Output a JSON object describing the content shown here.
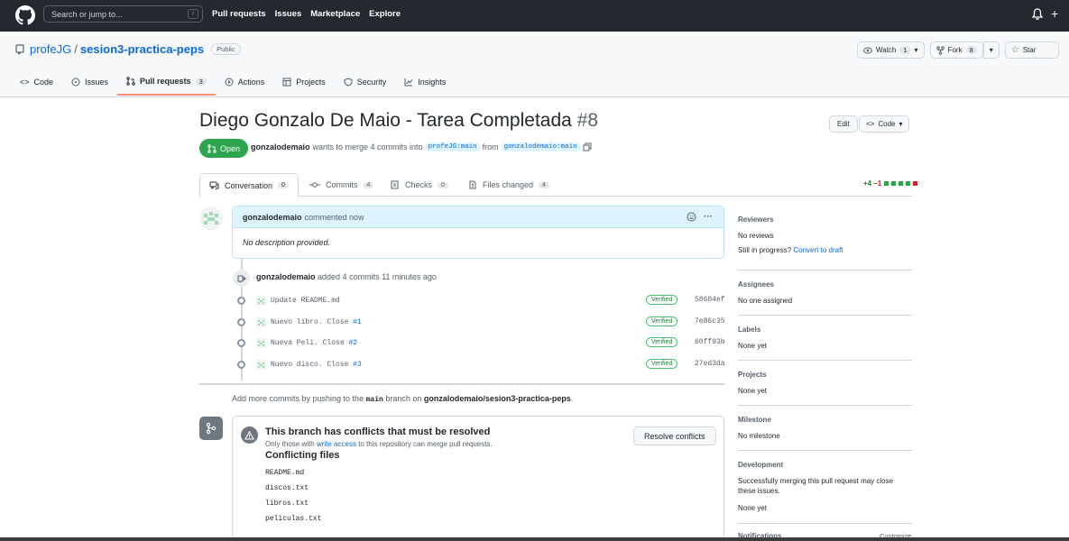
{
  "header": {
    "search_placeholder": "Search or jump to...",
    "search_shortcut": "/",
    "nav": [
      "Pull requests",
      "Issues",
      "Marketplace",
      "Explore"
    ],
    "plus": "+"
  },
  "repo": {
    "owner": "profeJG",
    "separator": "/",
    "name": "sesion3-practica-peps",
    "visibility": "Public",
    "watch_label": "Watch",
    "watch_count": "1",
    "fork_label": "Fork",
    "fork_count": "8",
    "star_label": "Star",
    "tabs": [
      {
        "label": "Code"
      },
      {
        "label": "Issues"
      },
      {
        "label": "Pull requests",
        "count": "3"
      },
      {
        "label": "Actions"
      },
      {
        "label": "Projects"
      },
      {
        "label": "Security"
      },
      {
        "label": "Insights"
      }
    ]
  },
  "pr": {
    "title": "Diego Gonzalo De Maio - Tarea Completada",
    "number": "#8",
    "edit_label": "Edit",
    "code_label": "Code",
    "state": "Open",
    "author": "gonzalodemaio",
    "merge_text": "wants to merge 4 commits into",
    "base_branch": "profeJG:main",
    "from_text": "from",
    "head_branch": "gonzalodemaio:main",
    "tabs": [
      {
        "label": "Conversation",
        "count": "0"
      },
      {
        "label": "Commits",
        "count": "4"
      },
      {
        "label": "Checks",
        "count": "0"
      },
      {
        "label": "Files changed",
        "count": "4"
      }
    ],
    "additions": "+4",
    "deletions": "−1"
  },
  "comment": {
    "author": "gonzalodemaio",
    "action": "commented now",
    "body": "No description provided.",
    "more": "···"
  },
  "push": {
    "author": "gonzalodemaio",
    "text": "added 4 commits 11 minutes ago"
  },
  "commits": [
    {
      "message": "Update README.md",
      "ref": "",
      "verified": "Verified",
      "sha": "58604ef"
    },
    {
      "message": "Nuevo libro. Close",
      "ref": "#1",
      "verified": "Verified",
      "sha": "7e86c35"
    },
    {
      "message": "Nueva Peli. Close",
      "ref": "#2",
      "verified": "Verified",
      "sha": "60ff93b"
    },
    {
      "message": "Nuevo disco. Close",
      "ref": "#3",
      "verified": "Verified",
      "sha": "27ed3da"
    }
  ],
  "addmore": {
    "pre": "Add more commits by pushing to the",
    "branch": "main",
    "mid": "branch on",
    "repo": "gonzalodemaio/sesion3-practica-peps",
    "end": "."
  },
  "conflicts": {
    "title": "This branch has conflicts that must be resolved",
    "sub_pre": "Only those with",
    "sub_link": "write access",
    "sub_post": "to this repository can merge pull requests.",
    "files_heading": "Conflicting files",
    "files": [
      "README.md",
      "discos.txt",
      "libros.txt",
      "peliculas.txt"
    ],
    "resolve_label": "Resolve conflicts"
  },
  "sidebar": {
    "reviewers_h": "Reviewers",
    "reviewers_v": "No reviews",
    "progress_pre": "Still in progress?",
    "progress_link": "Convert to draft",
    "assignees_h": "Assignees",
    "assignees_v": "No one assigned",
    "labels_h": "Labels",
    "labels_v": "None yet",
    "projects_h": "Projects",
    "projects_v": "None yet",
    "milestone_h": "Milestone",
    "milestone_v": "No milestone",
    "development_h": "Development",
    "development_v": "Successfully merging this pull request may close these issues.",
    "development_v2": "None yet",
    "notifications_h": "Notifications",
    "customize": "Customize"
  },
  "colors": {
    "open_green": "#2da44e",
    "link_blue": "#0969da",
    "header_dark": "#24292f",
    "tab_underline": "#fd8c73"
  }
}
